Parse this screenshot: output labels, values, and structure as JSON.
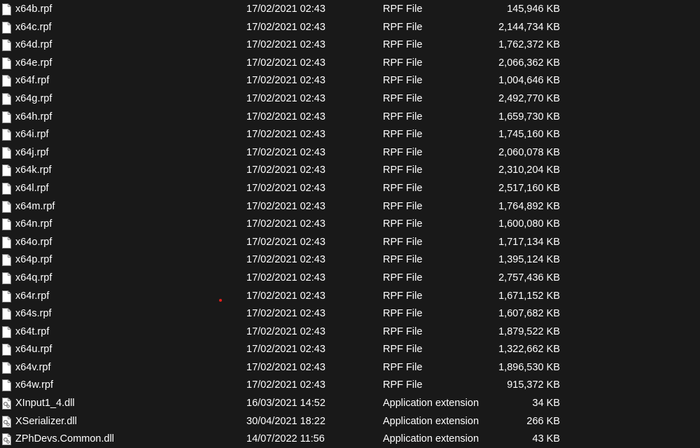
{
  "files": [
    {
      "name": "x64b.rpf",
      "date": "17/02/2021 02:43",
      "type": "RPF File",
      "size": "145,946 KB",
      "icon": "file-icon"
    },
    {
      "name": "x64c.rpf",
      "date": "17/02/2021 02:43",
      "type": "RPF File",
      "size": "2,144,734 KB",
      "icon": "file-icon"
    },
    {
      "name": "x64d.rpf",
      "date": "17/02/2021 02:43",
      "type": "RPF File",
      "size": "1,762,372 KB",
      "icon": "file-icon"
    },
    {
      "name": "x64e.rpf",
      "date": "17/02/2021 02:43",
      "type": "RPF File",
      "size": "2,066,362 KB",
      "icon": "file-icon"
    },
    {
      "name": "x64f.rpf",
      "date": "17/02/2021 02:43",
      "type": "RPF File",
      "size": "1,004,646 KB",
      "icon": "file-icon"
    },
    {
      "name": "x64g.rpf",
      "date": "17/02/2021 02:43",
      "type": "RPF File",
      "size": "2,492,770 KB",
      "icon": "file-icon"
    },
    {
      "name": "x64h.rpf",
      "date": "17/02/2021 02:43",
      "type": "RPF File",
      "size": "1,659,730 KB",
      "icon": "file-icon"
    },
    {
      "name": "x64i.rpf",
      "date": "17/02/2021 02:43",
      "type": "RPF File",
      "size": "1,745,160 KB",
      "icon": "file-icon"
    },
    {
      "name": "x64j.rpf",
      "date": "17/02/2021 02:43",
      "type": "RPF File",
      "size": "2,060,078 KB",
      "icon": "file-icon"
    },
    {
      "name": "x64k.rpf",
      "date": "17/02/2021 02:43",
      "type": "RPF File",
      "size": "2,310,204 KB",
      "icon": "file-icon"
    },
    {
      "name": "x64l.rpf",
      "date": "17/02/2021 02:43",
      "type": "RPF File",
      "size": "2,517,160 KB",
      "icon": "file-icon"
    },
    {
      "name": "x64m.rpf",
      "date": "17/02/2021 02:43",
      "type": "RPF File",
      "size": "1,764,892 KB",
      "icon": "file-icon"
    },
    {
      "name": "x64n.rpf",
      "date": "17/02/2021 02:43",
      "type": "RPF File",
      "size": "1,600,080 KB",
      "icon": "file-icon"
    },
    {
      "name": "x64o.rpf",
      "date": "17/02/2021 02:43",
      "type": "RPF File",
      "size": "1,717,134 KB",
      "icon": "file-icon"
    },
    {
      "name": "x64p.rpf",
      "date": "17/02/2021 02:43",
      "type": "RPF File",
      "size": "1,395,124 KB",
      "icon": "file-icon"
    },
    {
      "name": "x64q.rpf",
      "date": "17/02/2021 02:43",
      "type": "RPF File",
      "size": "2,757,436 KB",
      "icon": "file-icon"
    },
    {
      "name": "x64r.rpf",
      "date": "17/02/2021 02:43",
      "type": "RPF File",
      "size": "1,671,152 KB",
      "icon": "file-icon"
    },
    {
      "name": "x64s.rpf",
      "date": "17/02/2021 02:43",
      "type": "RPF File",
      "size": "1,607,682 KB",
      "icon": "file-icon"
    },
    {
      "name": "x64t.rpf",
      "date": "17/02/2021 02:43",
      "type": "RPF File",
      "size": "1,879,522 KB",
      "icon": "file-icon"
    },
    {
      "name": "x64u.rpf",
      "date": "17/02/2021 02:43",
      "type": "RPF File",
      "size": "1,322,662 KB",
      "icon": "file-icon"
    },
    {
      "name": "x64v.rpf",
      "date": "17/02/2021 02:43",
      "type": "RPF File",
      "size": "1,896,530 KB",
      "icon": "file-icon"
    },
    {
      "name": "x64w.rpf",
      "date": "17/02/2021 02:43",
      "type": "RPF File",
      "size": "915,372 KB",
      "icon": "file-icon"
    },
    {
      "name": "XInput1_4.dll",
      "date": "16/03/2021 14:52",
      "type": "Application extension",
      "size": "34 KB",
      "icon": "dll-icon"
    },
    {
      "name": "XSerializer.dll",
      "date": "30/04/2021 18:22",
      "type": "Application extension",
      "size": "266 KB",
      "icon": "dll-icon"
    },
    {
      "name": "ZPhDevs.Common.dll",
      "date": "14/07/2022 11:56",
      "type": "Application extension",
      "size": "43 KB",
      "icon": "dll-icon"
    }
  ],
  "colors": {
    "background": "#191919",
    "text": "#ffffff",
    "cursor_dot": "#e0201c"
  }
}
